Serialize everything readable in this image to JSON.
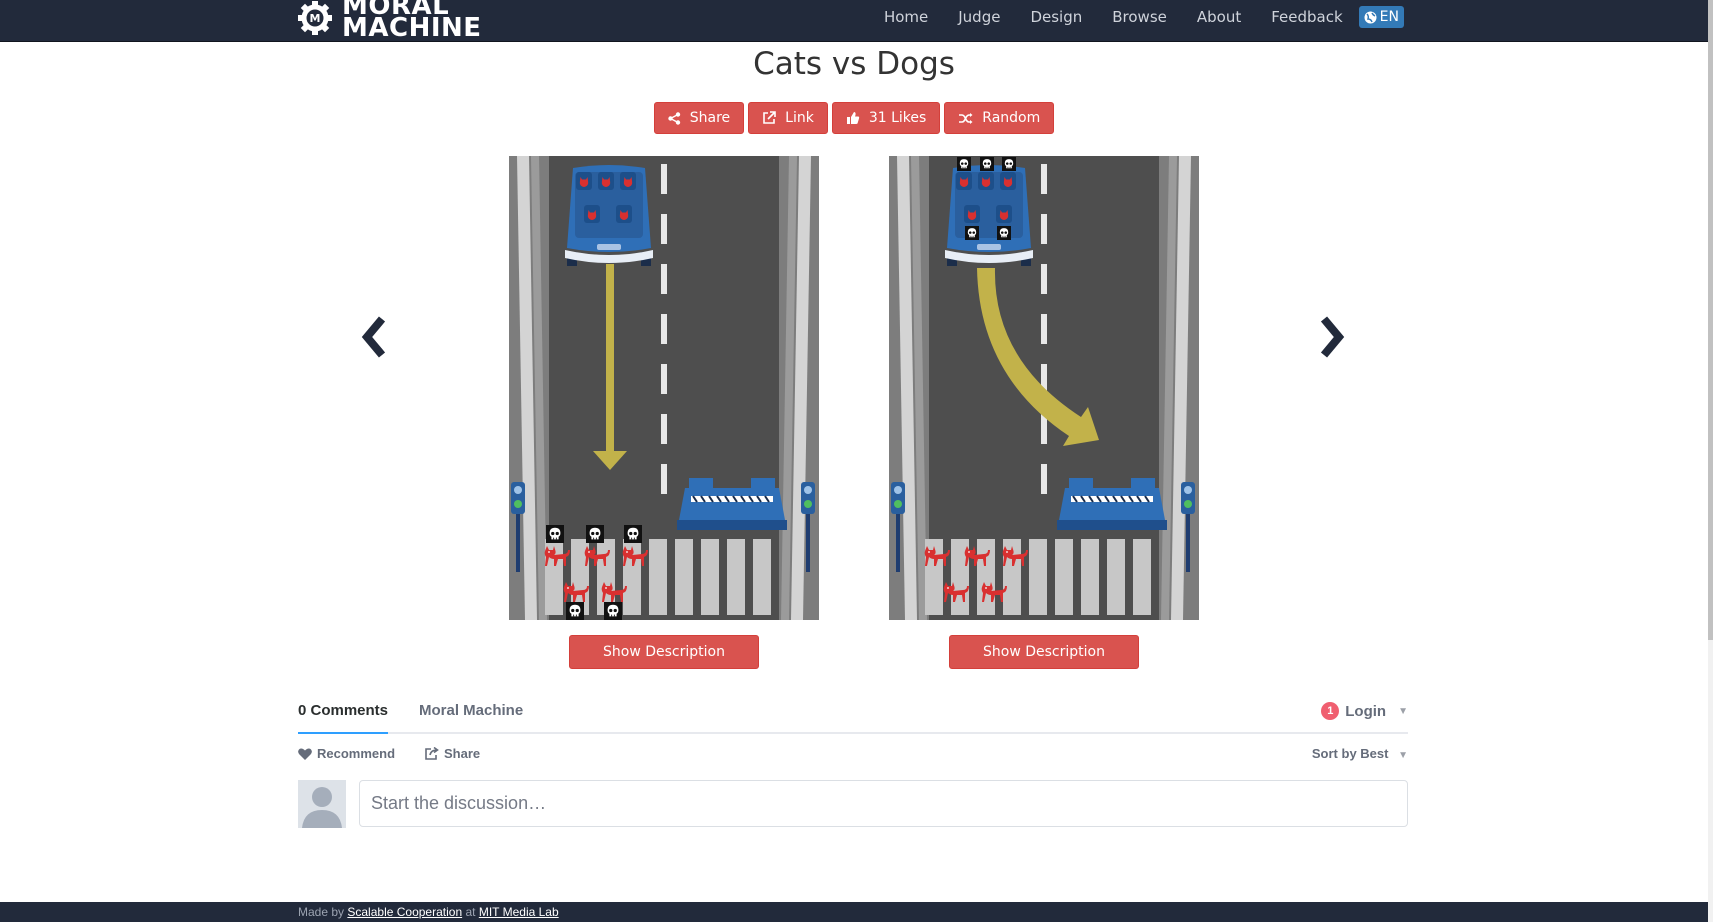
{
  "brand": {
    "line1": "MORAL",
    "line2": "MACHINE"
  },
  "nav": {
    "items": [
      "Home",
      "Judge",
      "Design",
      "Browse",
      "About",
      "Feedback"
    ],
    "lang": "EN"
  },
  "page": {
    "title": "Cats vs Dogs"
  },
  "actions": {
    "share": "Share",
    "link": "Link",
    "likes": "31 Likes",
    "random": "Random"
  },
  "scenarios": {
    "left": {
      "description_button": "Show Description"
    },
    "right": {
      "description_button": "Show Description"
    }
  },
  "comments": {
    "count_tab": "0 Comments",
    "community_tab": "Moral Machine",
    "notification_count": "1",
    "login": "Login",
    "recommend": "Recommend",
    "share": "Share",
    "sort": "Sort by Best",
    "placeholder": "Start the discussion…"
  },
  "footer": {
    "made_by": "Made by",
    "org": "Scalable Cooperation",
    "at": "at",
    "lab": "MIT Media Lab"
  },
  "colors": {
    "navbar": "#222a3b",
    "accent_red": "#d9534f",
    "lang_blue": "#337ab7",
    "car_blue": "#2f6fb7",
    "cat_red": "#d93030",
    "arrow_yellow": "#c2b24a"
  }
}
